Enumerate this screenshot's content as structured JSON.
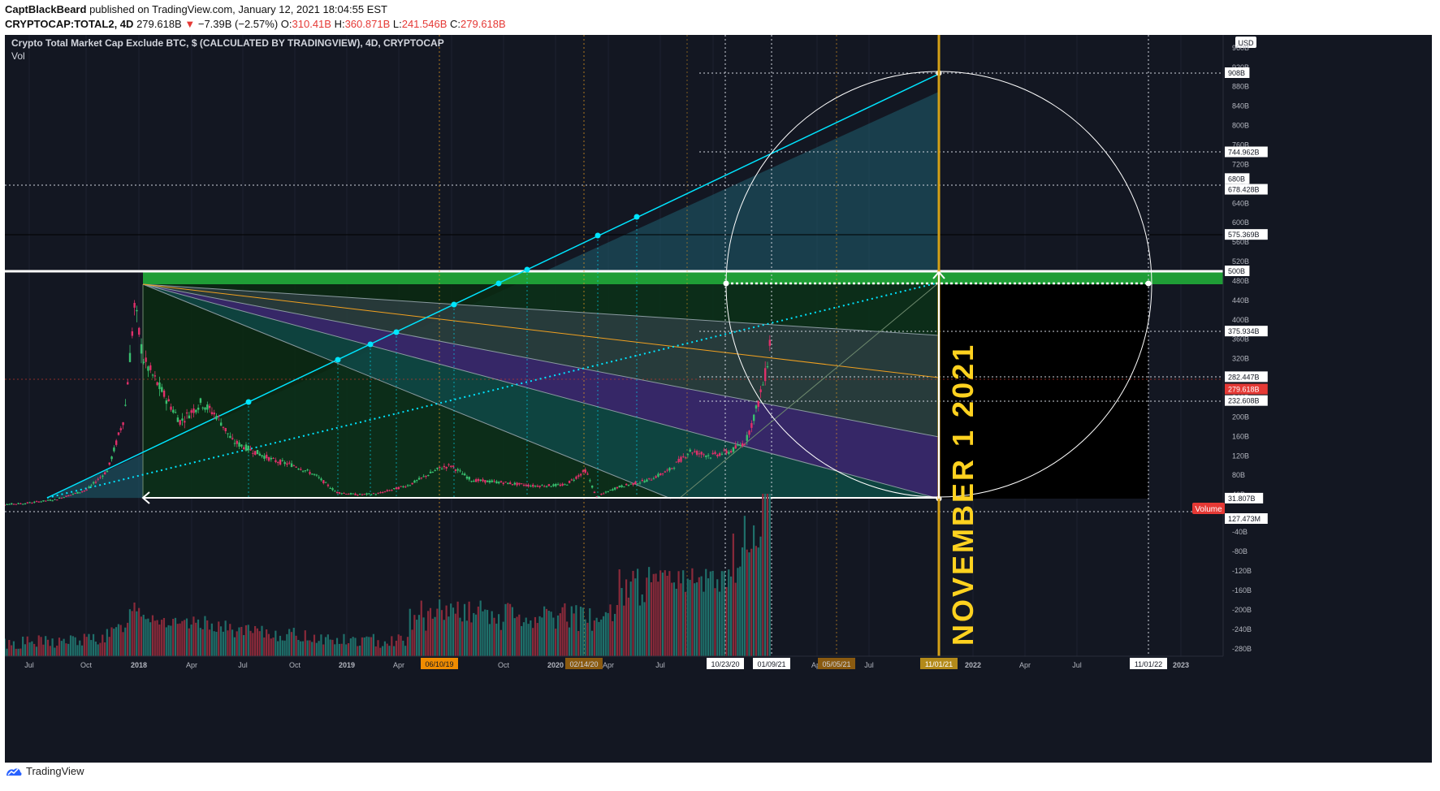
{
  "header": {
    "author": "CaptBlackBeard",
    "published_text": "published on TradingView.com, January 12, 2021 18:04:55 EST",
    "symbol": "CRYPTOCAP:TOTAL2, 4D",
    "last": "279.618B",
    "change": "−7.39B (−2.57%)",
    "open_label": "O:",
    "open": "310.41B",
    "high_label": "H:",
    "high": "360.871B",
    "low_label": "L:",
    "low": "241.546B",
    "close_label": "C:",
    "close": "279.618B"
  },
  "legend": {
    "title": "Crypto Total Market Cap Exclude BTC, $ (CALCULATED BY TRADINGVIEW), 4D, CRYPTOCAP",
    "vol": "Vol"
  },
  "currency": "USD",
  "annotation_text": "NOVEMBER 1 2021",
  "volume_label": "Volume",
  "footer_brand": "TradingView",
  "colors": {
    "background": "#131722",
    "up": "#26a69a",
    "down": "#ef5350",
    "fan": "#00e5ff",
    "orange": "#f0a020",
    "green_band": "#1f9d36",
    "purple": "#4a2a8c",
    "date_gold": "#b38a1a"
  },
  "chart_data": {
    "type": "candlestick",
    "title": "Crypto Total Market Cap Exclude BTC, $ (CALCULATED BY TRADINGVIEW), 4D, CRYPTOCAP",
    "timeframe": "4D",
    "price_axis": {
      "ticks": [
        "960B",
        "920B",
        "880B",
        "840B",
        "800B",
        "760B",
        "720B",
        "680B",
        "640B",
        "600B",
        "560B",
        "520B",
        "480B",
        "440B",
        "400B",
        "360B",
        "320B",
        "280B",
        "240B",
        "200B",
        "160B",
        "120B",
        "80B",
        "40B"
      ],
      "range": [
        0,
        960
      ]
    },
    "volume_axis": {
      "ticks": [
        "-40B",
        "-80B",
        "-120B",
        "-160B",
        "-200B",
        "-240B",
        "-280B"
      ]
    },
    "time_axis": [
      "Jul",
      "Oct",
      "2018",
      "Apr",
      "Jul",
      "Oct",
      "2019",
      "Apr",
      "Jul",
      "Oct",
      "2020",
      "Apr",
      "Jul",
      "Oct",
      "Apr",
      "Jul",
      "2022",
      "Apr",
      "Jul",
      "2023"
    ],
    "highlighted_dates": [
      "06/10/19",
      "02/14/20",
      "10/23/20",
      "01/09/21",
      "05/05/21",
      "11/01/21",
      "11/01/22"
    ],
    "price_labels": [
      {
        "text": "908B",
        "value": 908
      },
      {
        "text": "744.962B",
        "value": 745
      },
      {
        "text": "680B",
        "value": 680
      },
      {
        "text": "678.428B",
        "value": 678
      },
      {
        "text": "575.369B",
        "value": 575
      },
      {
        "text": "500B",
        "value": 500
      },
      {
        "text": "375.934B",
        "value": 376
      },
      {
        "text": "282.447B",
        "value": 282
      },
      {
        "text": "279.618B",
        "value": 280,
        "current": true
      },
      {
        "text": "232.608B",
        "value": 233
      },
      {
        "text": "31.807B",
        "value": 32
      },
      {
        "text": "127.473M",
        "value": 0
      }
    ],
    "price_path": [
      [
        2017.25,
        18
      ],
      [
        2017.45,
        22
      ],
      [
        2017.6,
        30
      ],
      [
        2017.75,
        50
      ],
      [
        2017.85,
        90
      ],
      [
        2017.93,
        200
      ],
      [
        2017.98,
        430
      ],
      [
        2018.02,
        320
      ],
      [
        2018.1,
        260
      ],
      [
        2018.2,
        190
      ],
      [
        2018.3,
        230
      ],
      [
        2018.38,
        200
      ],
      [
        2018.45,
        150
      ],
      [
        2018.55,
        130
      ],
      [
        2018.65,
        110
      ],
      [
        2018.75,
        100
      ],
      [
        2018.85,
        80
      ],
      [
        2018.95,
        45
      ],
      [
        2019.05,
        40
      ],
      [
        2019.15,
        42
      ],
      [
        2019.3,
        60
      ],
      [
        2019.45,
        95
      ],
      [
        2019.5,
        100
      ],
      [
        2019.6,
        70
      ],
      [
        2019.75,
        65
      ],
      [
        2019.9,
        58
      ],
      [
        2020.05,
        60
      ],
      [
        2020.1,
        75
      ],
      [
        2020.15,
        90
      ],
      [
        2020.2,
        35
      ],
      [
        2020.3,
        55
      ],
      [
        2020.45,
        70
      ],
      [
        2020.55,
        90
      ],
      [
        2020.65,
        130
      ],
      [
        2020.75,
        120
      ],
      [
        2020.85,
        130
      ],
      [
        2020.92,
        150
      ],
      [
        2020.98,
        230
      ],
      [
        2021.02,
        300
      ],
      [
        2021.04,
        375
      ],
      [
        2021.06,
        280
      ]
    ]
  }
}
